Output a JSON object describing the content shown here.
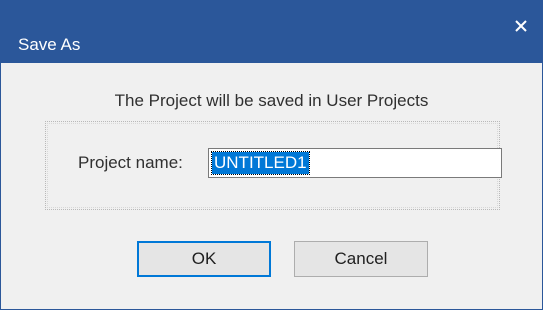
{
  "window": {
    "title": "Save As",
    "title_bar_color": "#2b579a",
    "close_icon": "close-icon"
  },
  "message": "The Project will be saved in User Projects",
  "form": {
    "project_name_label": "Project name:",
    "project_name_value": "UNTITLED1",
    "selection_color": "#0078d7"
  },
  "buttons": {
    "ok_label": "OK",
    "cancel_label": "Cancel"
  }
}
